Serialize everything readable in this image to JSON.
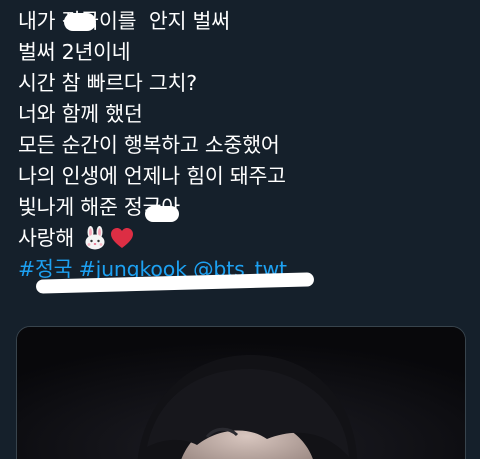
{
  "tweet": {
    "lines": [
      "내가 정국이를  안지 벌써",
      "벌써 2년이네",
      "시간 참 빠르다 그치?",
      "너와 함께 했던",
      "모든 순간이 행복하고 소중했어",
      "나의 인생에 언제나 힘이 돼주고",
      "빛나게 해준 정국아",
      "사랑해"
    ],
    "emoji": [
      "rabbit-face",
      "red-heart"
    ],
    "hashtags": [
      "#정국",
      "#jungkook"
    ],
    "mention": "@bts_twt"
  },
  "colors": {
    "background": "#15202b",
    "text": "#ffffff",
    "link": "#1da1f2"
  }
}
